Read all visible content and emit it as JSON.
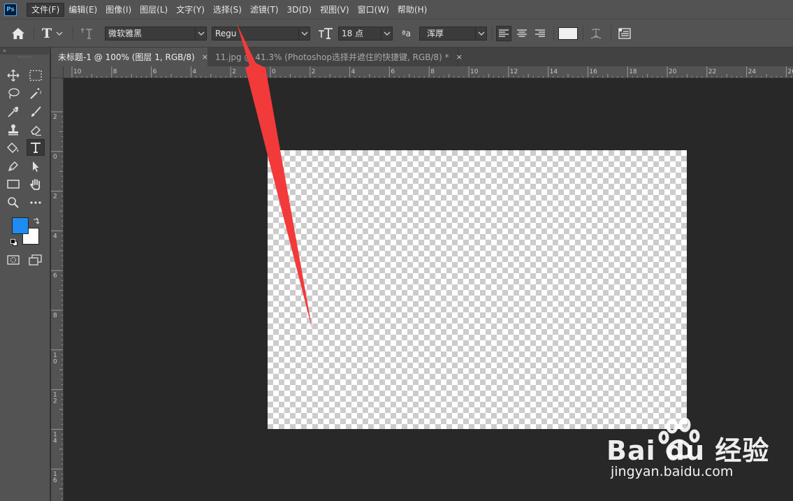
{
  "menu": {
    "app_icon": "Ps",
    "items": [
      "文件(F)",
      "编辑(E)",
      "图像(I)",
      "图层(L)",
      "文字(Y)",
      "选择(S)",
      "滤镜(T)",
      "3D(D)",
      "视图(V)",
      "窗口(W)",
      "帮助(H)"
    ]
  },
  "options": {
    "tool_glyph": "T",
    "font_family": "微软雅黑",
    "font_style": "Regu",
    "font_size": "18 点",
    "antialias_glyph": "ªa",
    "antialias": "浑厚",
    "text_color": "#f0f0f0"
  },
  "tools": {
    "collapse_glyph": "«",
    "foreground_color": "#1e8cf0",
    "background_color": "#ffffff"
  },
  "tabs": [
    {
      "label": "未标题-1 @ 100% (图层 1, RGB/8)",
      "close": "×",
      "active": true
    },
    {
      "label": "11.jpg @ 41.3% (Photoshop选择并遮住的快捷键, RGB/8) *",
      "close": "×",
      "active": false
    }
  ],
  "ruler_top_labels": [
    "10",
    "8",
    "6",
    "4",
    "2",
    "0",
    "2",
    "4",
    "6",
    "8",
    "10",
    "12",
    "14",
    "16",
    "18",
    "20",
    "22",
    "24",
    "26"
  ],
  "ruler_left_labels": [
    "2",
    "0",
    "2",
    "4",
    "6",
    "8",
    "10",
    "12",
    "14",
    "16"
  ],
  "annotation": {
    "arrow_color": "#f23a3a"
  },
  "watermark": {
    "brand": "Bai du 经验",
    "site": "jingyan.baidu.com"
  }
}
